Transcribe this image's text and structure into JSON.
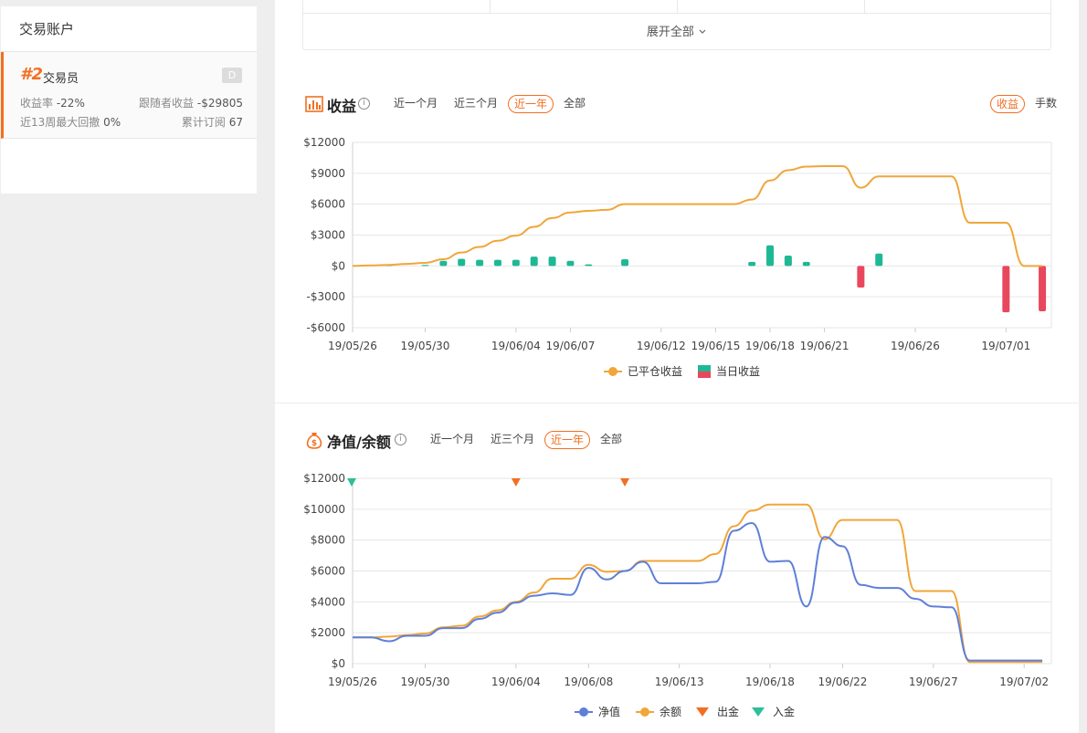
{
  "sidebar": {
    "title": "交易账户",
    "account": {
      "rank": "#2",
      "name": "交易员",
      "badge": "D",
      "return_label": "收益率",
      "return_value": "-22%",
      "follower_label": "跟随者收益",
      "follower_value": "-$29805",
      "drawdown_label": "近13周最大回撤",
      "drawdown_value": "0%",
      "subs_label": "累计订阅",
      "subs_value": "67"
    }
  },
  "summary": {
    "expand_label": "展开全部"
  },
  "profit_section": {
    "title": "收益",
    "info": "i",
    "tabs": [
      "近一个月",
      "近三个月",
      "近一年",
      "全部"
    ],
    "active_tab": "近一年",
    "toggles": [
      "收益",
      "手数"
    ],
    "active_toggle": "收益"
  },
  "equity_section": {
    "title": "净值/余额",
    "info": "i",
    "tabs": [
      "近一个月",
      "近三个月",
      "近一年",
      "全部"
    ],
    "active_tab": "近一年"
  },
  "colors": {
    "accent": "#f26f21",
    "orange_line": "#f0a63a",
    "green_bar": "#1fb895",
    "red_bar": "#e8475e",
    "blue_line": "#5f7fd8",
    "withdraw": "#f26f21",
    "deposit": "#2dbf9a"
  },
  "chart_data": [
    {
      "type": "line",
      "title": "收益",
      "x_ticks": [
        "19/05/26",
        "19/05/30",
        "19/06/04",
        "19/06/07",
        "19/06/12",
        "19/06/15",
        "19/06/18",
        "19/06/21",
        "19/06/26",
        "19/07/01"
      ],
      "y_ticks": [
        "$12000",
        "$9000",
        "$6000",
        "$3000",
        "$0",
        "-$3000",
        "-$6000"
      ],
      "ylim": [
        -6000,
        12000
      ],
      "series": [
        {
          "name": "已平仓收益",
          "type": "line",
          "x": [
            "19/05/26",
            "19/05/27",
            "19/05/28",
            "19/05/29",
            "19/05/30",
            "19/05/31",
            "19/06/01",
            "19/06/02",
            "19/06/03",
            "19/06/04",
            "19/06/05",
            "19/06/06",
            "19/06/07",
            "19/06/08",
            "19/06/09",
            "19/06/10",
            "19/06/11",
            "19/06/12",
            "19/06/13",
            "19/06/14",
            "19/06/15",
            "19/06/16",
            "19/06/17",
            "19/06/18",
            "19/06/19",
            "19/06/20",
            "19/06/21",
            "19/06/22",
            "19/06/23",
            "19/06/24",
            "19/06/25",
            "19/06/26",
            "19/06/27",
            "19/06/28",
            "19/06/29",
            "19/06/30",
            "19/07/01",
            "19/07/02",
            "19/07/03"
          ],
          "values": [
            0,
            50,
            100,
            200,
            300,
            650,
            1300,
            1850,
            2450,
            2950,
            3800,
            4650,
            5200,
            5350,
            5450,
            6000,
            6000,
            6000,
            6000,
            6000,
            6000,
            6000,
            6450,
            8300,
            9300,
            9650,
            9700,
            9700,
            7600,
            8700,
            8700,
            8700,
            8700,
            8700,
            4200,
            4200,
            4200,
            0,
            0
          ]
        },
        {
          "name": "当日收益",
          "type": "bar",
          "x": [
            "19/05/28",
            "19/05/30",
            "19/05/31",
            "19/06/01",
            "19/06/02",
            "19/06/03",
            "19/06/04",
            "19/06/05",
            "19/06/06",
            "19/06/07",
            "19/06/08",
            "19/06/10",
            "19/06/17",
            "19/06/18",
            "19/06/19",
            "19/06/20",
            "19/06/23",
            "19/06/24",
            "19/07/01",
            "19/07/03"
          ],
          "values": [
            100,
            100,
            500,
            700,
            600,
            600,
            600,
            900,
            900,
            500,
            150,
            650,
            400,
            2000,
            1000,
            400,
            -2100,
            1200,
            -4500,
            -4400
          ]
        }
      ],
      "legend": [
        "已平仓收益",
        "当日收益"
      ],
      "legend_position": "bottom"
    },
    {
      "type": "line",
      "title": "净值/余额",
      "x_ticks": [
        "19/05/26",
        "19/05/30",
        "19/06/04",
        "19/06/08",
        "19/06/13",
        "19/06/18",
        "19/06/22",
        "19/06/27",
        "19/07/02"
      ],
      "y_ticks": [
        "$12000",
        "$10000",
        "$8000",
        "$6000",
        "$4000",
        "$2000",
        "$0"
      ],
      "ylim": [
        0,
        12000
      ],
      "series": [
        {
          "name": "净值",
          "x": [
            "19/05/26",
            "19/05/27",
            "19/05/28",
            "19/05/29",
            "19/05/30",
            "19/05/31",
            "19/06/01",
            "19/06/02",
            "19/06/03",
            "19/06/04",
            "19/06/05",
            "19/06/06",
            "19/06/07",
            "19/06/08",
            "19/06/09",
            "19/06/10",
            "19/06/11",
            "19/06/12",
            "19/06/13",
            "19/06/14",
            "19/06/15",
            "19/06/16",
            "19/06/17",
            "19/06/18",
            "19/06/19",
            "19/06/20",
            "19/06/21",
            "19/06/22",
            "19/06/23",
            "19/06/24",
            "19/06/25",
            "19/06/26",
            "19/06/27",
            "19/06/28",
            "19/06/29",
            "19/06/30",
            "19/07/01",
            "19/07/02",
            "19/07/03"
          ],
          "values": [
            1700,
            1700,
            1450,
            1800,
            1800,
            2300,
            2300,
            2900,
            3300,
            3950,
            4400,
            4550,
            4450,
            6200,
            5450,
            6000,
            6600,
            5200,
            5200,
            5200,
            5300,
            8600,
            9100,
            6600,
            6650,
            3700,
            8200,
            7600,
            5100,
            4900,
            4900,
            4200,
            3700,
            3650,
            200,
            200,
            200,
            200,
            200
          ]
        },
        {
          "name": "余额",
          "x": [
            "19/05/26",
            "19/05/27",
            "19/05/28",
            "19/05/29",
            "19/05/30",
            "19/05/31",
            "19/06/01",
            "19/06/02",
            "19/06/03",
            "19/06/04",
            "19/06/05",
            "19/06/06",
            "19/06/07",
            "19/06/08",
            "19/06/09",
            "19/06/10",
            "19/06/11",
            "19/06/12",
            "19/06/13",
            "19/06/14",
            "19/06/15",
            "19/06/16",
            "19/06/17",
            "19/06/18",
            "19/06/19",
            "19/06/20",
            "19/06/21",
            "19/06/22",
            "19/06/23",
            "19/06/24",
            "19/06/25",
            "19/06/26",
            "19/06/27",
            "19/06/28",
            "19/06/29",
            "19/06/30",
            "19/07/01",
            "19/07/02",
            "19/07/03"
          ],
          "values": [
            1700,
            1700,
            1750,
            1850,
            1950,
            2350,
            2450,
            3050,
            3450,
            4000,
            4600,
            5500,
            5500,
            6400,
            5950,
            6000,
            6650,
            6650,
            6650,
            6650,
            7100,
            8900,
            9900,
            10300,
            10300,
            10300,
            8050,
            9300,
            9300,
            9300,
            9300,
            4700,
            4700,
            4700,
            100,
            100,
            100,
            100,
            100
          ]
        },
        {
          "name": "出金",
          "type": "marker",
          "x": [
            "19/06/04",
            "19/06/10"
          ]
        },
        {
          "name": "入金",
          "type": "marker",
          "x": [
            "19/05/26"
          ]
        }
      ],
      "legend": [
        "净值",
        "余额",
        "出金",
        "入金"
      ],
      "legend_position": "bottom"
    }
  ]
}
